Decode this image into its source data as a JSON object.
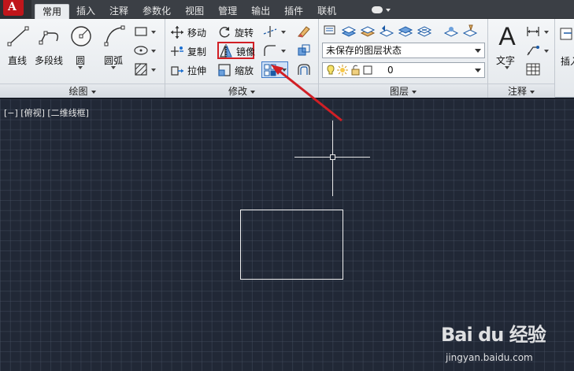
{
  "tabs": [
    {
      "label": "常用",
      "active": true
    },
    {
      "label": "插入"
    },
    {
      "label": "注释"
    },
    {
      "label": "参数化"
    },
    {
      "label": "视图"
    },
    {
      "label": "管理"
    },
    {
      "label": "输出"
    },
    {
      "label": "插件"
    },
    {
      "label": "联机"
    }
  ],
  "draw_panel": {
    "title": "绘图",
    "line": "直线",
    "polyline": "多段线",
    "circle": "圆",
    "arc": "圆弧"
  },
  "modify_panel": {
    "title": "修改",
    "move": "移动",
    "rotate": "旋转",
    "copy": "复制",
    "mirror": "镜像",
    "stretch": "拉伸",
    "scale": "缩放"
  },
  "layers_panel": {
    "title": "图层",
    "layer_state": "未保存的图层状态",
    "current_layer": "0"
  },
  "annotation_panel": {
    "title": "注释",
    "text": "文字",
    "text_glyph": "A"
  },
  "insert_panel": {
    "label": "插入"
  },
  "viewport": {
    "label": "[−] [俯视] [二维线框]"
  },
  "watermark": {
    "logo": "Bai du 经验",
    "url": "jingyan.baidu.com"
  },
  "colors": {
    "canvas": "#212836",
    "highlight": "#d11f25",
    "arrow": "#d11f25",
    "ribbon": "#e9ecef"
  }
}
